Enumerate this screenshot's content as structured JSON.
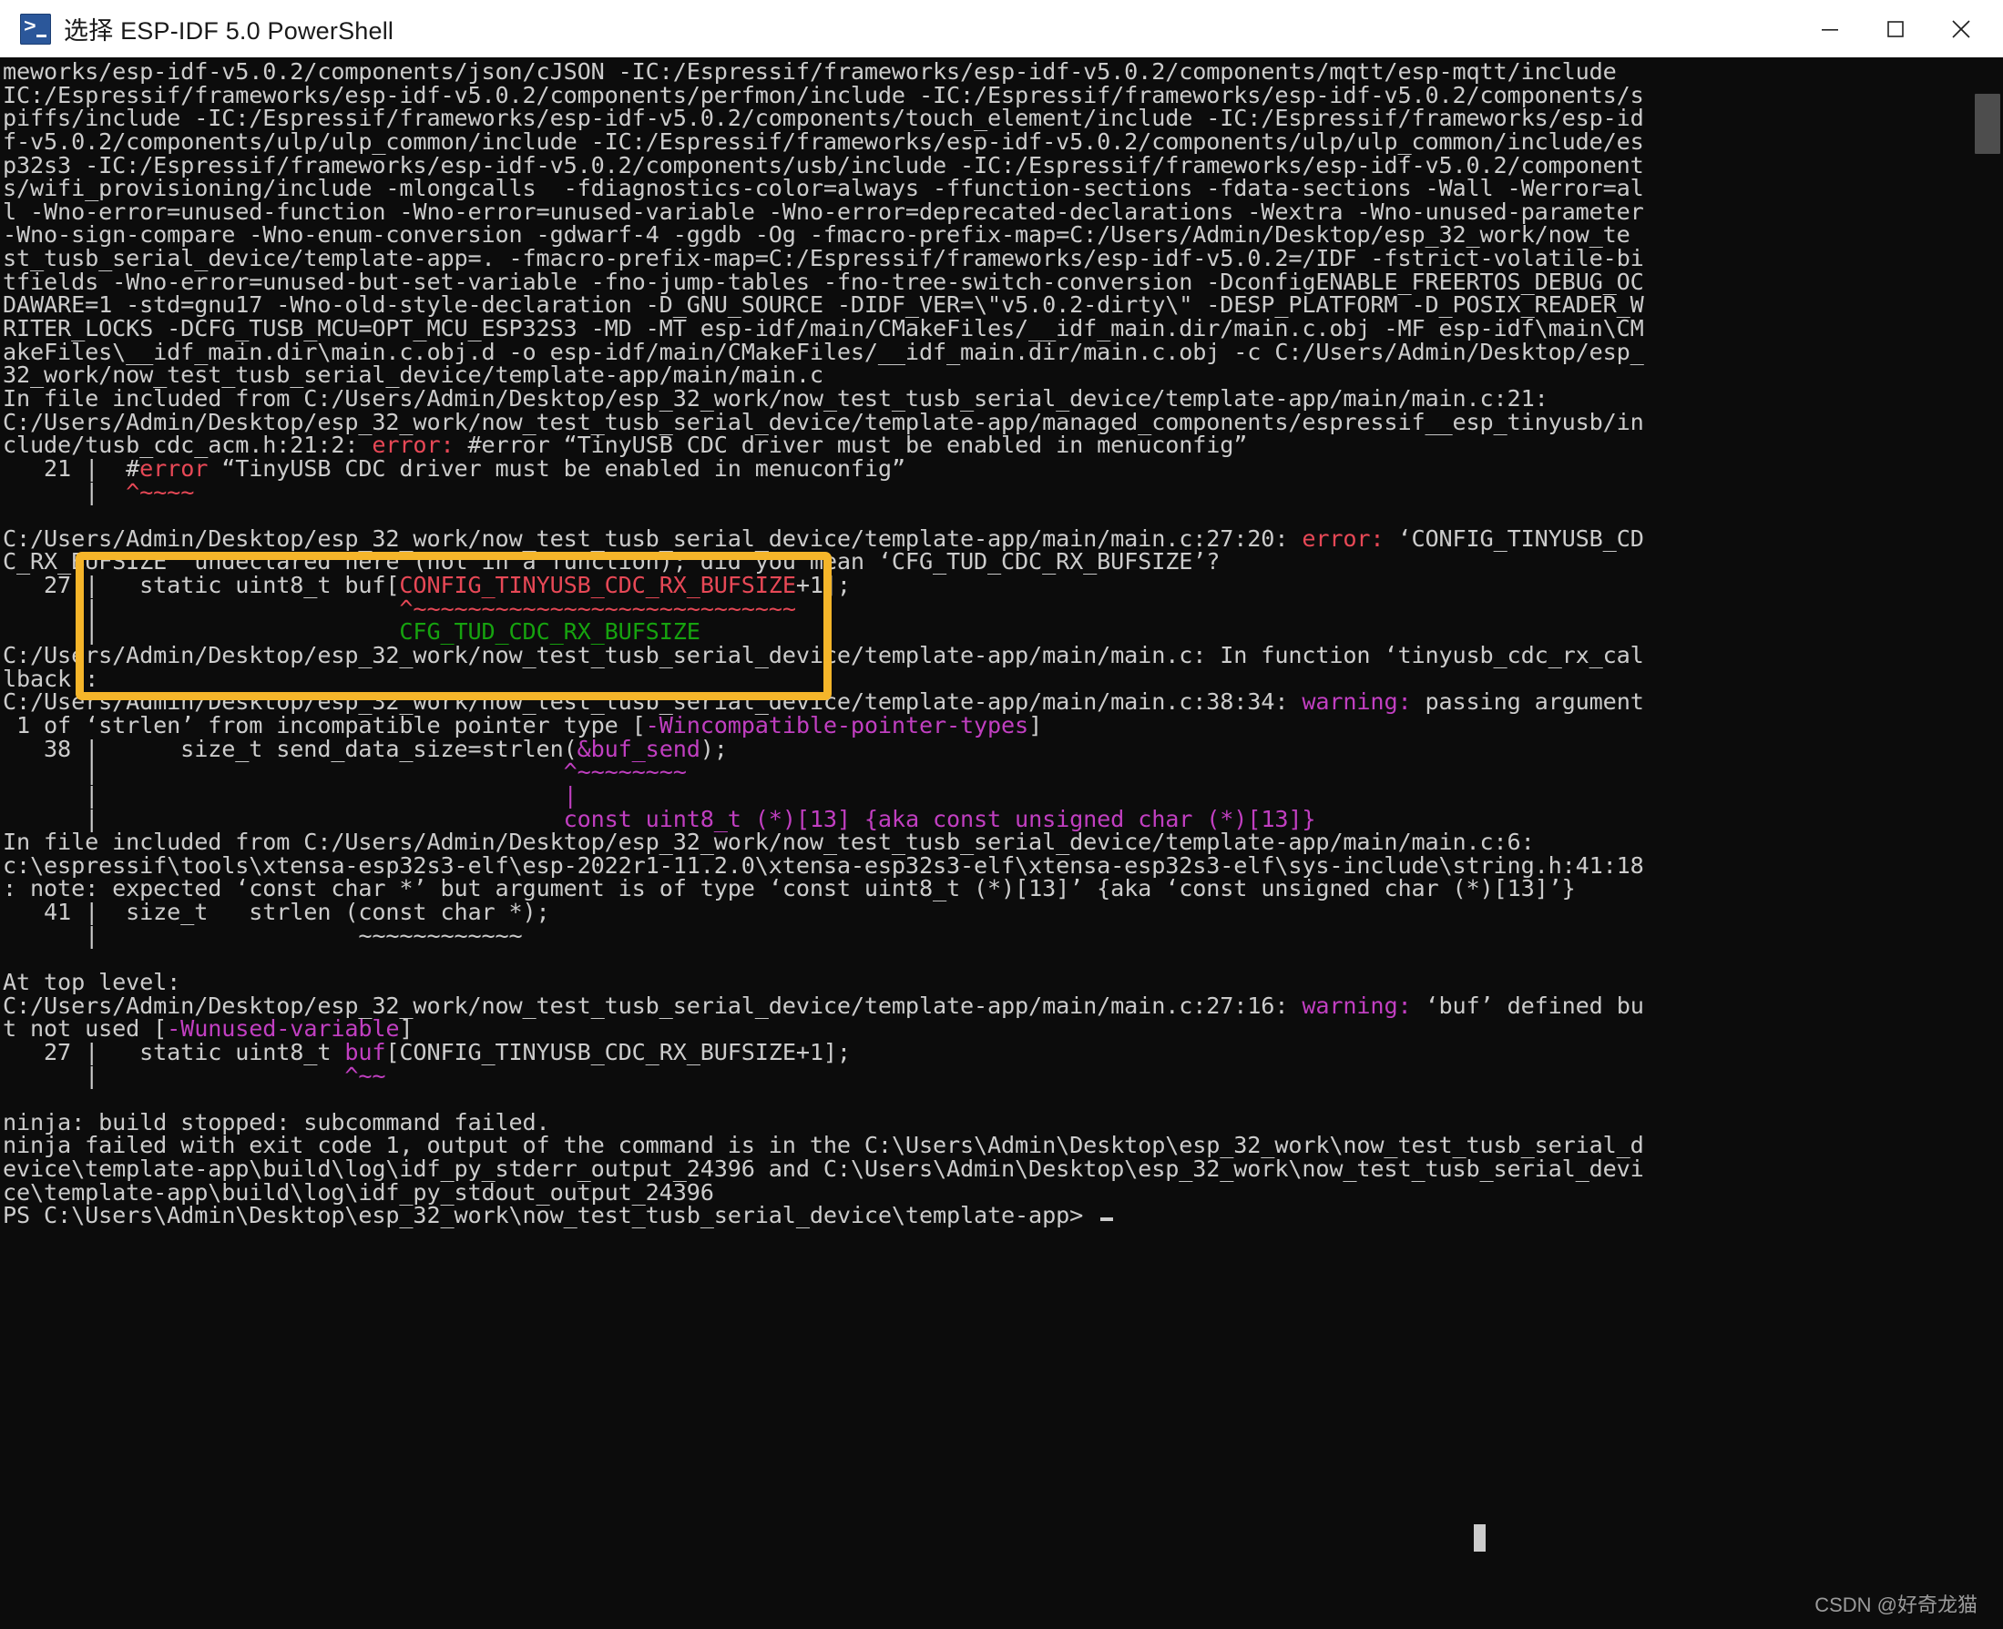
{
  "window": {
    "title": "选择 ESP-IDF 5.0 PowerShell",
    "icon": "powershell-icon",
    "minimize_label": "Minimize",
    "maximize_label": "Maximize",
    "close_label": "Close",
    "background_color": "#0c0c0c",
    "titlebar_color": "#ffffff"
  },
  "colors": {
    "text": "#cccccc",
    "error": "#e74856",
    "note_green": "#16a30f",
    "warning_magenta": "#c13fc1",
    "annotation_box": "#f5b52a",
    "scrollbar_thumb": "#4d4d4d"
  },
  "annotation": {
    "name": "yellow-highlight-box",
    "target_text": "#error \"TinyUSB CDC driver must be enabled in menuconfig\""
  },
  "watermark": {
    "text": "CSDN @好奇龙猫"
  },
  "terminal": {
    "prompt": "PS C:\\Users\\Admin\\Desktop\\esp_32_work\\now_test_tusb_serial_device\\template-app>",
    "lines": [
      [
        {
          "t": "meworks/esp-idf-v5.0.2/components/json/cJSON -IC:/Espressif/frameworks/esp-idf-v5.0.2/components/mqtt/esp-mqtt/include",
          "c": "def"
        }
      ],
      [
        {
          "t": "IC:/Espressif/frameworks/esp-idf-v5.0.2/components/perfmon/include -IC:/Espressif/frameworks/esp-idf-v5.0.2/components/s",
          "c": "def"
        }
      ],
      [
        {
          "t": "piffs/include -IC:/Espressif/frameworks/esp-idf-v5.0.2/components/touch_element/include -IC:/Espressif/frameworks/esp-id",
          "c": "def"
        }
      ],
      [
        {
          "t": "f-v5.0.2/components/ulp/ulp_common/include -IC:/Espressif/frameworks/esp-idf-v5.0.2/components/ulp/ulp_common/include/es",
          "c": "def"
        }
      ],
      [
        {
          "t": "p32s3 -IC:/Espressif/frameworks/esp-idf-v5.0.2/components/usb/include -IC:/Espressif/frameworks/esp-idf-v5.0.2/component",
          "c": "def"
        }
      ],
      [
        {
          "t": "s/wifi_provisioning/include -mlongcalls  -fdiagnostics-color=always -ffunction-sections -fdata-sections -Wall -Werror=al",
          "c": "def"
        }
      ],
      [
        {
          "t": "l -Wno-error=unused-function -Wno-error=unused-variable -Wno-error=deprecated-declarations -Wextra -Wno-unused-parameter",
          "c": "def"
        }
      ],
      [
        {
          "t": "-Wno-sign-compare -Wno-enum-conversion -gdwarf-4 -ggdb -Og -fmacro-prefix-map=C:/Users/Admin/Desktop/esp_32_work/now_te",
          "c": "def"
        }
      ],
      [
        {
          "t": "st_tusb_serial_device/template-app=. -fmacro-prefix-map=C:/Espressif/frameworks/esp-idf-v5.0.2=/IDF -fstrict-volatile-bi",
          "c": "def"
        }
      ],
      [
        {
          "t": "tfields -Wno-error=unused-but-set-variable -fno-jump-tables -fno-tree-switch-conversion -DconfigENABLE_FREERTOS_DEBUG_OC",
          "c": "def"
        }
      ],
      [
        {
          "t": "DAWARE=1 -std=gnu17 -Wno-old-style-declaration -D_GNU_SOURCE -DIDF_VER=\\\"v5.0.2-dirty\\\" -DESP_PLATFORM -D_POSIX_READER_W",
          "c": "def"
        }
      ],
      [
        {
          "t": "RITER_LOCKS -DCFG_TUSB_MCU=OPT_MCU_ESP32S3 -MD -MT esp-idf/main/CMakeFiles/__idf_main.dir/main.c.obj -MF esp-idf\\main\\CM",
          "c": "def"
        }
      ],
      [
        {
          "t": "akeFiles\\__idf_main.dir\\main.c.obj.d -o esp-idf/main/CMakeFiles/__idf_main.dir/main.c.obj -c C:/Users/Admin/Desktop/esp_",
          "c": "def"
        }
      ],
      [
        {
          "t": "32_work/now_test_tusb_serial_device/template-app/main/main.c",
          "c": "def"
        }
      ],
      [
        {
          "t": "In file included from C:/Users/Admin/Desktop/esp_32_work/now_test_tusb_serial_device/template-app/main/main.c:21:",
          "c": "def"
        }
      ],
      [
        {
          "t": "C:/Users/Admin/Desktop/esp_32_work/now_test_tusb_serial_device/template-app/managed_components/espressif__esp_tinyusb/in",
          "c": "def"
        }
      ],
      [
        {
          "t": "clude/tusb_cdc_acm.h:21:2: ",
          "c": "def"
        },
        {
          "t": "error: ",
          "c": "red"
        },
        {
          "t": "#error “TinyUSB CDC driver must be enabled in menuconfig”",
          "c": "def"
        }
      ],
      [
        {
          "t": "   21 |  #",
          "c": "def"
        },
        {
          "t": "error",
          "c": "red"
        },
        {
          "t": " “TinyUSB CDC driver must be enabled in menuconfig”",
          "c": "def"
        }
      ],
      [
        {
          "t": "      |  ",
          "c": "def"
        },
        {
          "t": "^~~~~",
          "c": "red"
        }
      ],
      [
        {
          "t": "",
          "c": "def"
        }
      ],
      [
        {
          "t": "C:/Users/Admin/Desktop/esp_32_work/now_test_tusb_serial_device/template-app/main/main.c:27:20: ",
          "c": "def"
        },
        {
          "t": "error: ",
          "c": "red"
        },
        {
          "t": "‘CONFIG_TINYUSB_CD",
          "c": "def"
        }
      ],
      [
        {
          "t": "C_RX_BUFSIZE’ undeclared here (not in a function); did you mean ‘CFG_TUD_CDC_RX_BUFSIZE’?",
          "c": "def"
        }
      ],
      [
        {
          "t": "   27 |   static uint8_t buf[",
          "c": "def"
        },
        {
          "t": "CONFIG_TINYUSB_CDC_RX_BUFSIZE",
          "c": "red"
        },
        {
          "t": "+1];",
          "c": "def"
        }
      ],
      [
        {
          "t": "      |                      ",
          "c": "def"
        },
        {
          "t": "^~~~~~~~~~~~~~~~~~~~~~~~~~~~~",
          "c": "red"
        }
      ],
      [
        {
          "t": "      |                      ",
          "c": "def"
        },
        {
          "t": "CFG_TUD_CDC_RX_BUFSIZE",
          "c": "green"
        }
      ],
      [
        {
          "t": "C:/Users/Admin/Desktop/esp_32_work/now_test_tusb_serial_device/template-app/main/main.c: In function ‘tinyusb_cdc_rx_cal",
          "c": "def"
        }
      ],
      [
        {
          "t": "lback’:",
          "c": "def"
        }
      ],
      [
        {
          "t": "C:/Users/Admin/Desktop/esp_32_work/now_test_tusb_serial_device/template-app/main/main.c:38:34: ",
          "c": "def"
        },
        {
          "t": "warning: ",
          "c": "mag"
        },
        {
          "t": "passing argument",
          "c": "def"
        }
      ],
      [
        {
          "t": " 1 of ‘strlen’ from incompatible pointer type [",
          "c": "def"
        },
        {
          "t": "-Wincompatible-pointer-types",
          "c": "mag"
        },
        {
          "t": "]",
          "c": "def"
        }
      ],
      [
        {
          "t": "   38 |      size_t send_data_size=strlen(",
          "c": "def"
        },
        {
          "t": "&buf_send",
          "c": "mag"
        },
        {
          "t": ");",
          "c": "def"
        }
      ],
      [
        {
          "t": "      |                                  ",
          "c": "def"
        },
        {
          "t": "^~~~~~~~~",
          "c": "mag"
        }
      ],
      [
        {
          "t": "      |                                  ",
          "c": "def"
        },
        {
          "t": "|",
          "c": "mag"
        }
      ],
      [
        {
          "t": "      |                                  ",
          "c": "def"
        },
        {
          "t": "const uint8_t (*)[13] {aka const unsigned char (*)[13]}",
          "c": "mag"
        }
      ],
      [
        {
          "t": "In file included from C:/Users/Admin/Desktop/esp_32_work/now_test_tusb_serial_device/template-app/main/main.c:6:",
          "c": "def"
        }
      ],
      [
        {
          "t": "c:\\espressif\\tools\\xtensa-esp32s3-elf\\esp-2022r1-11.2.0\\xtensa-esp32s3-elf\\xtensa-esp32s3-elf\\sys-include\\string.h:41:18",
          "c": "def"
        }
      ],
      [
        {
          "t": ": ",
          "c": "def"
        },
        {
          "t": "note: ",
          "c": "def"
        },
        {
          "t": "expected ‘const char *’ but argument is of type ‘const uint8_t (*)[13]’ {aka ‘const unsigned char (*)[13]’}",
          "c": "def"
        }
      ],
      [
        {
          "t": "   41 |  size_t   strlen (",
          "c": "def"
        },
        {
          "t": "const char *",
          "c": "def"
        },
        {
          "t": ");",
          "c": "def"
        }
      ],
      [
        {
          "t": "      |                   ",
          "c": "def"
        },
        {
          "t": "~~~~~~~~~~~~",
          "c": "def"
        }
      ],
      [
        {
          "t": "",
          "c": "def"
        }
      ],
      [
        {
          "t": "At top level:",
          "c": "def"
        }
      ],
      [
        {
          "t": "C:/Users/Admin/Desktop/esp_32_work/now_test_tusb_serial_device/template-app/main/main.c:27:16: ",
          "c": "def"
        },
        {
          "t": "warning: ",
          "c": "mag"
        },
        {
          "t": "‘buf’ defined bu",
          "c": "def"
        }
      ],
      [
        {
          "t": "t not used [",
          "c": "def"
        },
        {
          "t": "-Wunused-variable",
          "c": "mag"
        },
        {
          "t": "]",
          "c": "def"
        }
      ],
      [
        {
          "t": "   27 |   static uint8_t ",
          "c": "def"
        },
        {
          "t": "buf",
          "c": "mag"
        },
        {
          "t": "[CONFIG_TINYUSB_CDC_RX_BUFSIZE+1];",
          "c": "def"
        }
      ],
      [
        {
          "t": "      |                  ",
          "c": "def"
        },
        {
          "t": "^~~",
          "c": "mag"
        }
      ],
      [
        {
          "t": "",
          "c": "def"
        }
      ],
      [
        {
          "t": "ninja: build stopped: subcommand failed.",
          "c": "def"
        }
      ],
      [
        {
          "t": "ninja failed with exit code 1, output of the command is in the C:\\Users\\Admin\\Desktop\\esp_32_work\\now_test_tusb_serial_d",
          "c": "def"
        }
      ],
      [
        {
          "t": "evice\\template-app\\build\\log\\idf_py_stderr_output_24396 and C:\\Users\\Admin\\Desktop\\esp_32_work\\now_test_tusb_serial_devi",
          "c": "def"
        }
      ],
      [
        {
          "t": "ce\\template-app\\build\\log\\idf_py_stdout_output_24396",
          "c": "def"
        }
      ],
      [
        {
          "t": "PS C:\\Users\\Admin\\Desktop\\esp_32_work\\now_test_tusb_serial_device\\template-app> ",
          "c": "def"
        }
      ]
    ]
  }
}
